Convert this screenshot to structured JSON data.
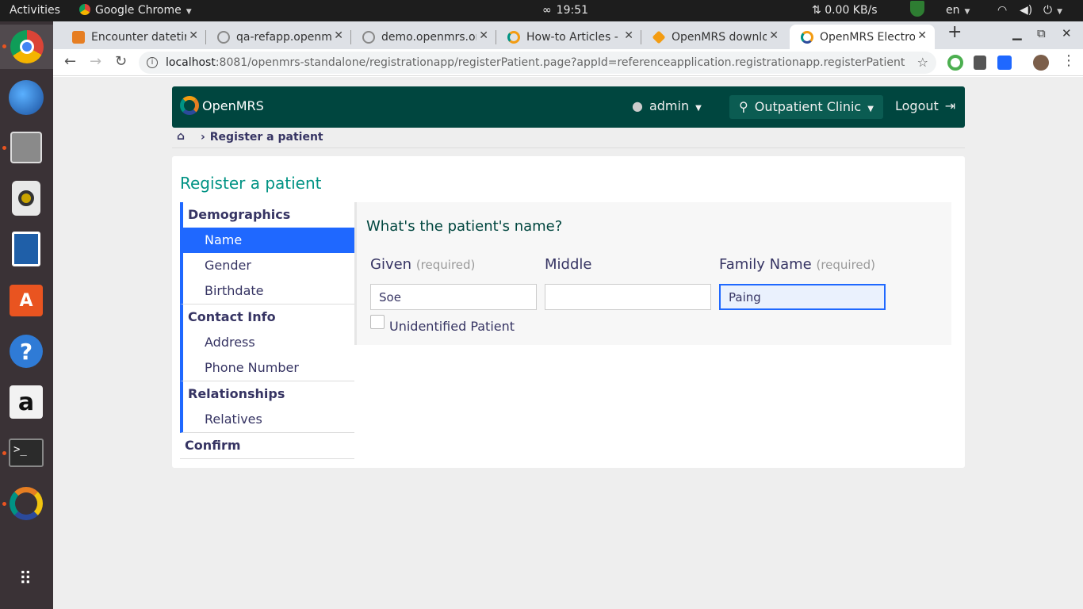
{
  "os": {
    "activities": "Activities",
    "app_menu": "Google Chrome",
    "clock": "19:51",
    "net_speed": "0.00 KB/s",
    "lang": "en"
  },
  "tabs": [
    {
      "label": "Encounter datetir",
      "favicon_color": "#e67e22"
    },
    {
      "label": "qa-refapp.openm",
      "favicon_color": "#888888"
    },
    {
      "label": "demo.openmrs.or",
      "favicon_color": "#888888"
    },
    {
      "label": "How-to Articles -",
      "favicon_color": "#f39c12"
    },
    {
      "label": "OpenMRS downlo",
      "favicon_color": "#f39c12"
    },
    {
      "label": "OpenMRS Electro",
      "favicon_color": "#f39c12"
    }
  ],
  "browser": {
    "url_host": "localhost",
    "url_rest": ":8081/openmrs-standalone/registrationapp/registerPatient.page?appId=referenceapplication.registrationapp.registerPatient"
  },
  "header": {
    "brand": "OpenMRS",
    "user": "admin",
    "location": "Outpatient Clinic",
    "logout": "Logout"
  },
  "breadcrumb": {
    "current": "Register a patient"
  },
  "page_title": "Register a patient",
  "nav": {
    "demographics": "Demographics",
    "name": "Name",
    "gender": "Gender",
    "birthdate": "Birthdate",
    "contact": "Contact Info",
    "address": "Address",
    "phone": "Phone Number",
    "relationships": "Relationships",
    "relatives": "Relatives",
    "confirm": "Confirm"
  },
  "form": {
    "question": "What's the patient's name?",
    "given_label": "Given",
    "given_req": "(required)",
    "given_value": "Soe",
    "middle_label": "Middle",
    "middle_value": "",
    "family_label": "Family Name",
    "family_req": "(required)",
    "family_value": "Paing",
    "unidentified": "Unidentified Patient"
  }
}
